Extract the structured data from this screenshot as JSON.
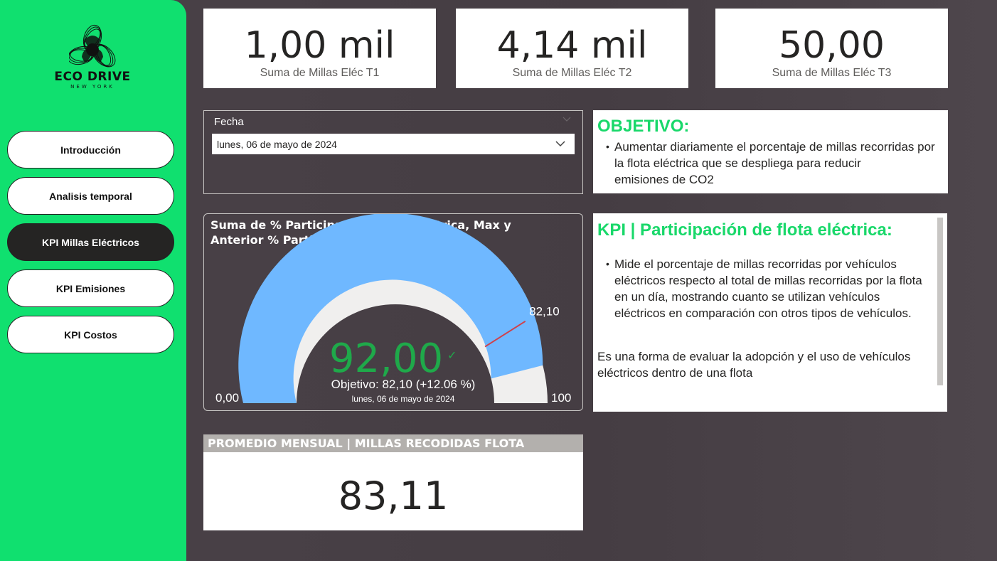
{
  "sidebar": {
    "logo_title": "ECO DRIVE",
    "logo_subtitle": "NEW YORK",
    "nav": [
      {
        "label": "Introducción",
        "active": false
      },
      {
        "label": "Analisis temporal",
        "active": false
      },
      {
        "label": "KPI Millas Eléctricos",
        "active": true
      },
      {
        "label": "KPI Emisiones",
        "active": false
      },
      {
        "label": "KPI Costos",
        "active": false
      }
    ]
  },
  "cards": [
    {
      "value": "1,00 mil",
      "label": "Suma de Millas Eléc T1"
    },
    {
      "value": "4,14 mil",
      "label": "Suma de Millas Eléc T2"
    },
    {
      "value": "50,00",
      "label": "Suma de Millas Eléc T3"
    }
  ],
  "slicer": {
    "title": "Fecha",
    "selected": "lunes, 06 de mayo de 2024"
  },
  "objective": {
    "title": "OBJETIVO:",
    "bullet": "Aumentar diariamente el porcentaje de millas recorridas por la flota eléctrica que se despliega para reducir emisiones de CO2",
    "lines": [
      "Aumentar diariamente el porcentaje de millas recorridas por",
      "la flota eléctrica que se despliega para reducir",
      "emisiones de CO2"
    ]
  },
  "gauge": {
    "title": "Suma de % Participación Flota Eléctrica, Max y Anterior % Participación Flota Eléctrica",
    "value": 92.0,
    "value_label": "92,00",
    "min": 0,
    "max": 100,
    "min_label": "0,00",
    "max_label": "100",
    "target": 82.1,
    "target_label": "82,10",
    "target_text": "Objetivo: 82,10 (+12.06 %)",
    "date_text": "lunes, 06 de mayo de 2024",
    "check_icon": "check-icon",
    "colors": {
      "fill": "#6fb8ff",
      "track": "#f0efee",
      "target": "#d0404a",
      "value": "#1fa94a"
    }
  },
  "kpi_desc": {
    "title": "KPI | Participación de flota eléctrica:",
    "bullet_lines": [
      "Mide el porcentaje de millas recorridas por vehículos",
      "eléctricos respecto al total de millas recorridas por la flota",
      "en un día, mostrando cuanto se utilizan vehículos",
      "eléctricos en comparación con otros tipos de vehículos."
    ],
    "para_lines": [
      "Es una forma de evaluar la adopción y el uso de vehículos",
      "eléctricos dentro de una flota"
    ]
  },
  "monthly": {
    "title": "PROMEDIO MENSUAL | MILLAS RECODIDAS FLOTA ELECTRICA",
    "value": "83,11"
  }
}
